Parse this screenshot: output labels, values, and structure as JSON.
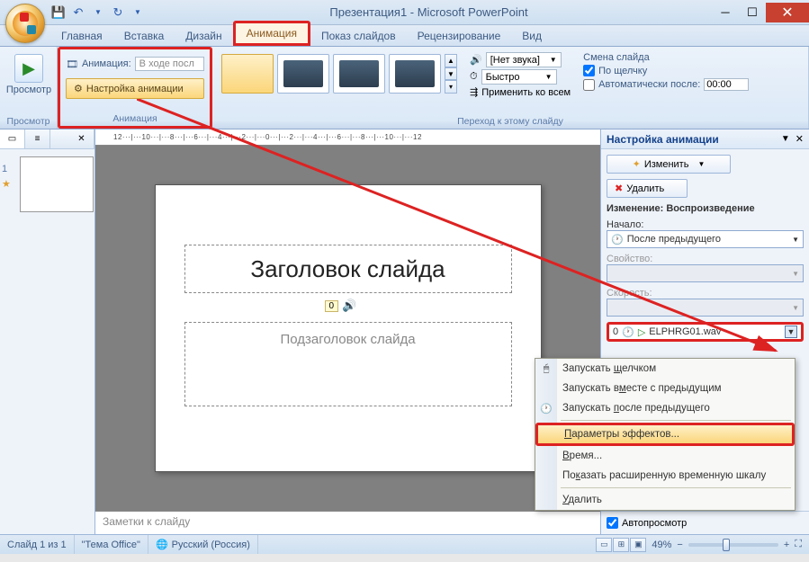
{
  "window": {
    "title": "Презентация1 - Microsoft PowerPoint"
  },
  "tabs": {
    "home": "Главная",
    "insert": "Вставка",
    "design": "Дизайн",
    "animation": "Анимация",
    "slideshow": "Показ слайдов",
    "review": "Рецензирование",
    "view": "Вид"
  },
  "ribbon": {
    "preview_group": "Просмотр",
    "preview_btn": "Просмотр",
    "animation_group": "Анимация",
    "animation_label": "Анимация:",
    "animation_value": "В ходе посл",
    "custom_animation": "Настройка анимации",
    "transition_group": "Переход к этому слайду",
    "sound_none": "[Нет звука]",
    "speed_fast": "Быстро",
    "apply_all": "Применить ко всем",
    "slide_change_title": "Смена слайда",
    "on_click": "По щелчку",
    "auto_after": "Автоматически после:",
    "auto_time": "00:00"
  },
  "slide": {
    "title_placeholder": "Заголовок слайда",
    "subtitle_placeholder": "Подзаголовок слайда",
    "badge": "0"
  },
  "ruler": "12···|···10···|···8···|···6···|···4···|···2···|···0···|···2···|···4···|···6···|···8···|···10···|···12",
  "pane": {
    "title": "Настройка анимации",
    "modify_btn": "Изменить",
    "delete_btn": "Удалить",
    "change_header": "Изменение: Воспроизведение",
    "start_label": "Начало:",
    "start_value": "После предыдущего",
    "property_label": "Свойство:",
    "speed_label": "Скорость:",
    "item_index": "0",
    "item_name": "ELPHRG01.wav",
    "autopreview": "Автопросмотр"
  },
  "context_menu": {
    "start_click": "Запускать щелчком",
    "start_with": "Запускать вместе с предыдущим",
    "start_after": "Запускать после предыдущего",
    "effect_options": "Параметры эффектов...",
    "timing": "Время...",
    "show_timeline": "Показать расширенную временную шкалу",
    "remove": "Удалить"
  },
  "notes": "Заметки к слайду",
  "status": {
    "slide_info": "Слайд 1 из 1",
    "theme": "\"Тема Office\"",
    "language": "Русский (Россия)",
    "zoom": "49%"
  }
}
